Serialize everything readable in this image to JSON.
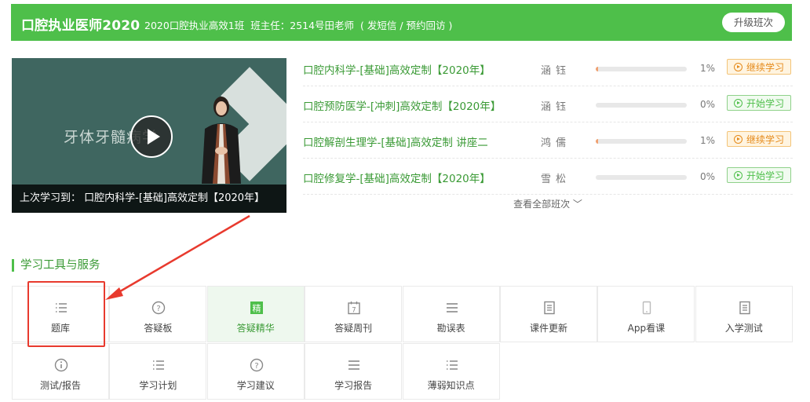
{
  "header": {
    "title": "口腔执业医师2020",
    "class_name": "2020口腔执业高效1班",
    "head_teacher": "班主任：2514号田老师",
    "contact": "( 发短信 / 预约回访 )",
    "upgrade_label": "升级班次"
  },
  "video": {
    "watermark": "牙体牙髓病学",
    "caption": "上次学习到： 口腔内科学-[基础]高效定制【2020年】"
  },
  "courses": [
    {
      "name": "口腔内科学-[基础]高效定制【2020年】",
      "teacher": "涵钰",
      "progress": 0.01,
      "percent": "1%",
      "action": "继续学习",
      "kind": "cont"
    },
    {
      "name": "口腔预防医学-[冲刺]高效定制【2020年】",
      "teacher": "涵钰",
      "progress": 0,
      "percent": "0%",
      "action": "开始学习",
      "kind": "start"
    },
    {
      "name": "口腔解剖生理学-[基础]高效定制 讲座二",
      "teacher": "鸿儒",
      "progress": 0.01,
      "percent": "1%",
      "action": "继续学习",
      "kind": "cont"
    },
    {
      "name": "口腔修复学-[基础]高效定制【2020年】",
      "teacher": "雪松",
      "progress": 0,
      "percent": "0%",
      "action": "开始学习",
      "kind": "start"
    }
  ],
  "view_all": "查看全部班次 ﹀",
  "tools_section": {
    "title": "学习工具与服务",
    "items": [
      {
        "label": "题库",
        "icon": "list-icon"
      },
      {
        "label": "答疑板",
        "icon": "question-icon"
      },
      {
        "label": "答疑精华",
        "icon": "essence-icon",
        "glyph": "精"
      },
      {
        "label": "答疑周刊",
        "icon": "calendar-icon",
        "glyph": "7"
      },
      {
        "label": "勘误表",
        "icon": "menu-icon"
      },
      {
        "label": "课件更新",
        "icon": "document-icon"
      },
      {
        "label": "App看课",
        "icon": "phone-icon"
      },
      {
        "label": "入学测试",
        "icon": "document-icon"
      },
      {
        "label": "测试/报告",
        "icon": "info-icon"
      },
      {
        "label": "学习计划",
        "icon": "list-icon"
      },
      {
        "label": "学习建议",
        "icon": "question-icon"
      },
      {
        "label": "学习报告",
        "icon": "menu-icon"
      },
      {
        "label": "薄弱知识点",
        "icon": "list-icon"
      }
    ]
  },
  "colors": {
    "brand": "#4ebf4a",
    "continue": "#e58a1a",
    "highlight": "#e83a2e"
  }
}
